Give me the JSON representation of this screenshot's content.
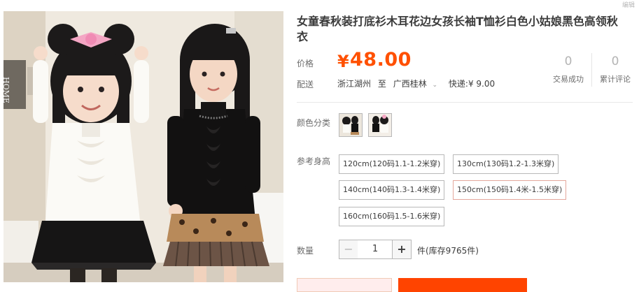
{
  "watermark": "编辑",
  "product": {
    "title": "女童春秋装打底衫木耳花边女孩长袖T恤衫白色小姑娘黑色高领秋衣"
  },
  "price": {
    "label": "价格",
    "currency": "¥",
    "value": "48.00"
  },
  "stats": [
    {
      "num": "0",
      "label": "交易成功"
    },
    {
      "num": "0",
      "label": "累计评论"
    }
  ],
  "shipping": {
    "label": "配送",
    "from": "浙江湖州",
    "to_word": "至",
    "to": "广西桂林",
    "express": "快递:¥ 9.00"
  },
  "color": {
    "label": "颜色分类"
  },
  "size": {
    "label": "参考身高",
    "options": [
      "120cm(120码1.1-1.2米穿)",
      "130cm(130码1.2-1.3米穿)",
      "140cm(140码1.3-1.4米穿)",
      "150cm(150码1.4米-1.5米穿)",
      "160cm(160码1.5-1.6米穿)"
    ],
    "selected": "150cm(150码1.4米-1.5米穿)"
  },
  "quantity": {
    "label": "数量",
    "minus": "−",
    "value": "1",
    "plus": "+",
    "stock": "件(库存9765件)"
  },
  "icons": {
    "chevron": "chevron-down-icon"
  }
}
